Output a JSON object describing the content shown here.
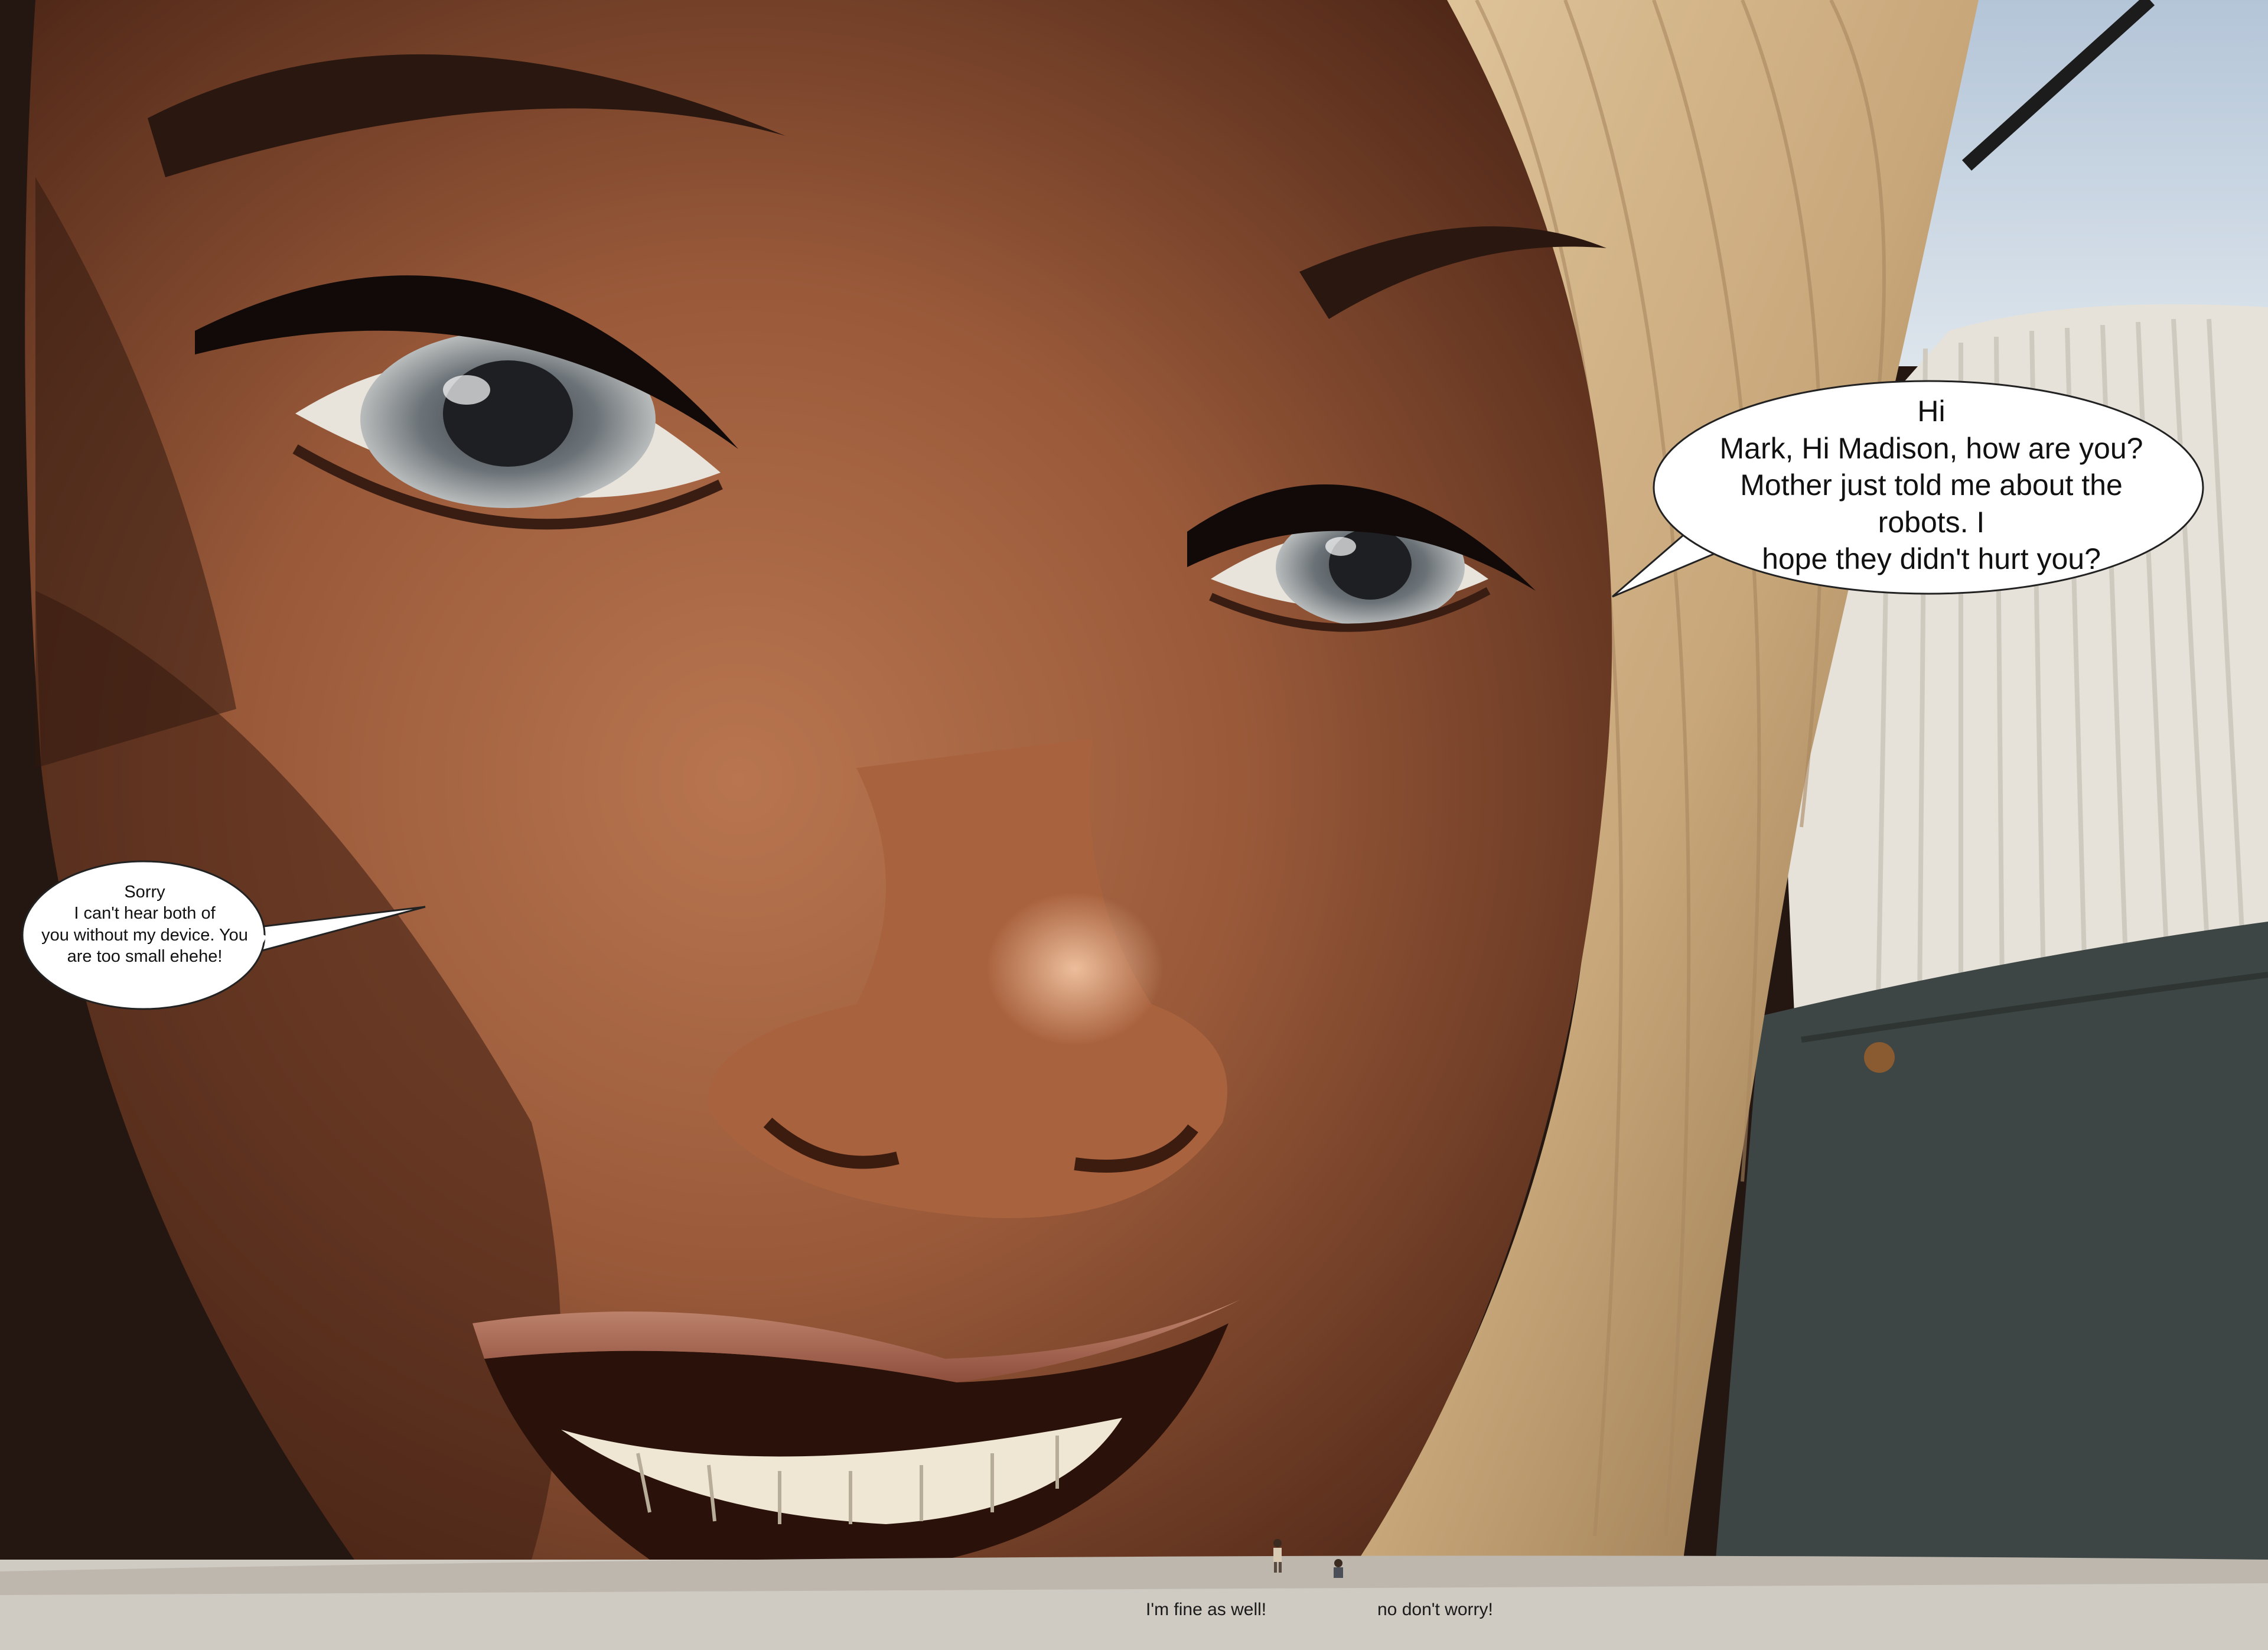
{
  "speech_bubbles": {
    "giantess": {
      "lines": [
        "Hi",
        "Mark, Hi Madison, how are you?",
        "Mother just told me about the robots. I",
        "hope they didn't hurt you?"
      ]
    },
    "reply_sorry": {
      "lines": [
        "Sorry",
        "I can't hear both of",
        "you without my device. You",
        "are too small ehehe!"
      ]
    }
  },
  "captions": {
    "left": "I'm fine as well!",
    "right": "no don't worry!"
  },
  "colors": {
    "skin_mid": "#9a5a3a",
    "skin_shadow": "#4a2415",
    "hair_blonde": "#c8a77a",
    "sweater": "#e6e2da",
    "jeans": "#3d4644",
    "ground": "#cfcac2",
    "sky": "#c9d6e4"
  }
}
